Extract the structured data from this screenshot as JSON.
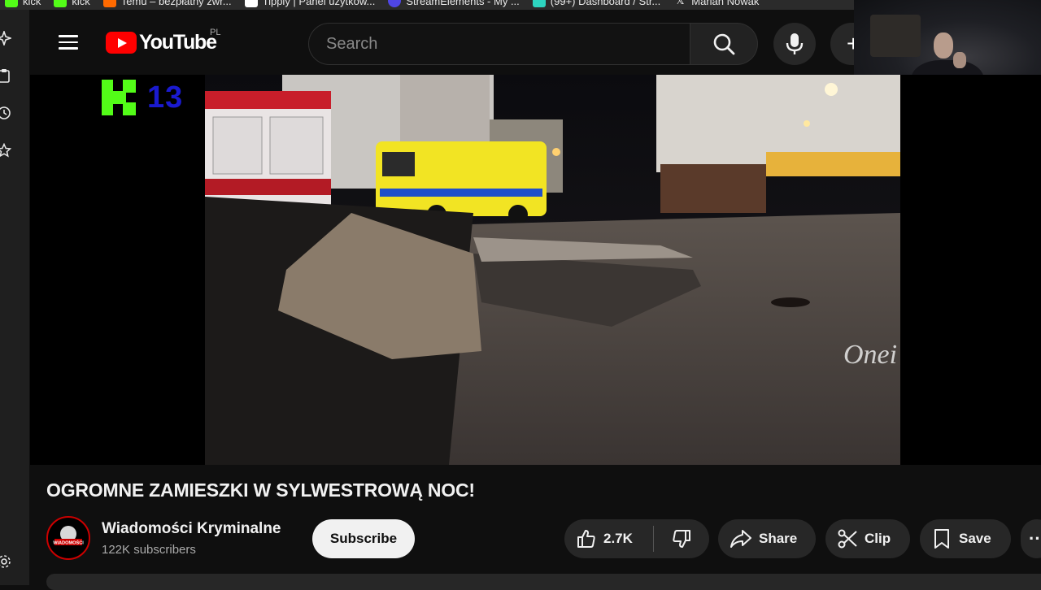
{
  "bookmarks": [
    {
      "label": "kick",
      "icon": "kick-icon",
      "color": "#53fc18"
    },
    {
      "label": "kick",
      "icon": "kick-icon",
      "color": "#53fc18"
    },
    {
      "label": "Temu – bezpłatny zwr...",
      "icon": "temu-icon",
      "color": "#ff6a00"
    },
    {
      "label": "Tipply | Panel użytkow...",
      "icon": "tipply-icon",
      "color": "#ffffff"
    },
    {
      "label": "StreamElements - My ...",
      "icon": "streamelements-icon",
      "color": "#4f46e5"
    },
    {
      "label": "(99+) Dashboard / Str...",
      "icon": "dashboard-icon",
      "color": "#2dd4bf"
    },
    {
      "label": "Marian Nowak",
      "icon": "x-icon",
      "color": "#ffffff"
    }
  ],
  "masthead": {
    "logo_text": "YouTube",
    "region": "PL",
    "search_placeholder": "Search",
    "create_label": "+"
  },
  "player": {
    "overlay_badge_number": "13",
    "video_watermark": "Onei"
  },
  "video": {
    "title": "OGROMNE ZAMIESZKI W SYLWESTROWĄ NOC!",
    "channel_name": "Wiadomości Kryminalne",
    "channel_avatar_text": "WIADOMOŚCI",
    "subscribers": "122K subscribers",
    "subscribe_label": "Subscribe",
    "like_count": "2.7K",
    "share_label": "Share",
    "clip_label": "Clip",
    "save_label": "Save",
    "more_label": "···"
  },
  "colors": {
    "background": "#0f0f0f",
    "youtube_red": "#ff0000",
    "pill": "#272727",
    "subscribe_bg": "#f1f1f1",
    "kick_green": "#53fc18"
  }
}
